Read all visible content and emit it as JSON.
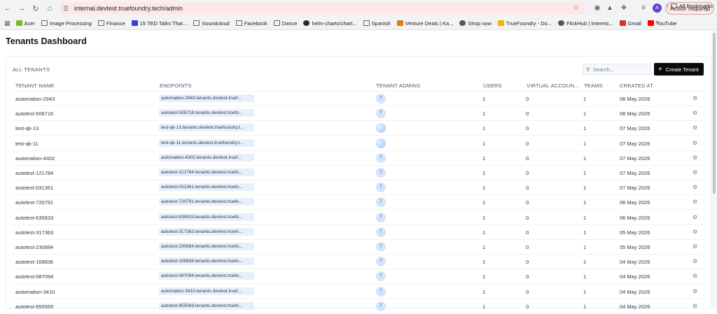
{
  "browser": {
    "url": "internal.devtest.truefoundry.tech/admin",
    "action_required": "Action required",
    "profile_initial": "A",
    "bookmarks": [
      {
        "label": "Acer",
        "icon": "acer-icon"
      },
      {
        "label": "Image Processing",
        "icon": "folder-icon"
      },
      {
        "label": "Finance",
        "icon": "folder-icon"
      },
      {
        "label": "15 TED Talks That...",
        "icon": "ted-icon"
      },
      {
        "label": "Soundcloud",
        "icon": "folder-icon"
      },
      {
        "label": "Facebook",
        "icon": "folder-icon"
      },
      {
        "label": "Dance",
        "icon": "folder-icon"
      },
      {
        "label": "helm-charts/chart...",
        "icon": "github-icon"
      },
      {
        "label": "Spanish",
        "icon": "folder-icon"
      },
      {
        "label": "Venture Deals | Ka...",
        "icon": "kindle-icon"
      },
      {
        "label": "Shop now",
        "icon": "globe-icon"
      },
      {
        "label": "TrueFoundry - Do...",
        "icon": "drive-icon"
      },
      {
        "label": "FlickHub | Interest...",
        "icon": "globe-icon"
      },
      {
        "label": "Gmail",
        "icon": "gmail-icon"
      },
      {
        "label": "YouTube",
        "icon": "youtube-icon"
      }
    ],
    "all_bookmarks": "All Bookmarks"
  },
  "page": {
    "title": "Tenants Dashboard",
    "section_label": "ALL TENANTS",
    "search_placeholder": "Search...",
    "create_button": "Create Tenant"
  },
  "table": {
    "headers": {
      "name": "TENANT NAME",
      "endpoints": "ENDPOINTS",
      "admins": "TENANT ADMINS",
      "users": "USERS",
      "virtual": "VIRTUAL ACCOUN...",
      "teams": "TEAMS",
      "created": "CREATED AT"
    },
    "rows": [
      {
        "name": "automation-2943",
        "endpoint": "automation-2943.tenants.devtest.truef...",
        "admin": "T",
        "admin_type": "initial",
        "users": "1",
        "virtual": "0",
        "teams": "1",
        "created": "08 May 2026"
      },
      {
        "name": "autotest-506716",
        "endpoint": "autotest-506716.tenants.devtest.truefo...",
        "admin": "T",
        "admin_type": "initial",
        "users": "1",
        "virtual": "0",
        "teams": "1",
        "created": "08 May 2026"
      },
      {
        "name": "test-qk-13",
        "endpoint": "test-qk-13.tenants.devtest.truefoundry.t...",
        "admin": "",
        "admin_type": "image",
        "users": "1",
        "virtual": "0",
        "teams": "1",
        "created": "07 May 2026"
      },
      {
        "name": "test-qk-11",
        "endpoint": "test-qk-11.tenants.devtest.truefoundry.t...",
        "admin": "",
        "admin_type": "image",
        "users": "1",
        "virtual": "0",
        "teams": "1",
        "created": "07 May 2026"
      },
      {
        "name": "automation-4302",
        "endpoint": "automation-4302.tenants.devtest.truef...",
        "admin": "T",
        "admin_type": "initial",
        "users": "1",
        "virtual": "0",
        "teams": "1",
        "created": "07 May 2026"
      },
      {
        "name": "autotest-121784",
        "endpoint": "autotest-121784.tenants.devtest.truefo...",
        "admin": "T",
        "admin_type": "initial",
        "users": "1",
        "virtual": "0",
        "teams": "1",
        "created": "07 May 2026"
      },
      {
        "name": "autotest-031361",
        "endpoint": "autotest-031361.tenants.devtest.truefo...",
        "admin": "T",
        "admin_type": "initial",
        "users": "1",
        "virtual": "0",
        "teams": "1",
        "created": "07 May 2026"
      },
      {
        "name": "autotest-720791",
        "endpoint": "autotest-720791.tenants.devtest.truefo...",
        "admin": "T",
        "admin_type": "initial",
        "users": "1",
        "virtual": "0",
        "teams": "1",
        "created": "06 May 2026"
      },
      {
        "name": "autotest-635633",
        "endpoint": "autotest-635633.tenants.devtest.truefo...",
        "admin": "T",
        "admin_type": "initial",
        "users": "1",
        "virtual": "0",
        "teams": "1",
        "created": "06 May 2026"
      },
      {
        "name": "autotest-317363",
        "endpoint": "autotest-317363.tenants.devtest.truefo...",
        "admin": "T",
        "admin_type": "initial",
        "users": "1",
        "virtual": "0",
        "teams": "1",
        "created": "05 May 2026"
      },
      {
        "name": "autotest-230684",
        "endpoint": "autotest-230684.tenants.devtest.truefo...",
        "admin": "T",
        "admin_type": "initial",
        "users": "1",
        "virtual": "0",
        "teams": "1",
        "created": "05 May 2026"
      },
      {
        "name": "autotest-168836",
        "endpoint": "autotest-168836.tenants.devtest.truefo...",
        "admin": "T",
        "admin_type": "initial",
        "users": "1",
        "virtual": "0",
        "teams": "1",
        "created": "04 May 2026"
      },
      {
        "name": "autotest-087094",
        "endpoint": "autotest-087094.tenants.devtest.truefo...",
        "admin": "T",
        "admin_type": "initial",
        "users": "1",
        "virtual": "0",
        "teams": "1",
        "created": "04 May 2026"
      },
      {
        "name": "automation-3410",
        "endpoint": "automation-3410.tenants.devtest.truef...",
        "admin": "T",
        "admin_type": "initial",
        "users": "1",
        "virtual": "0",
        "teams": "1",
        "created": "04 May 2026"
      },
      {
        "name": "autotest-955569",
        "endpoint": "autotest-955569.tenants.devtest.truefo...",
        "admin": "T",
        "admin_type": "initial",
        "users": "1",
        "virtual": "0",
        "teams": "1",
        "created": "04 May 2026"
      }
    ]
  },
  "colors": {
    "accent_dark": "#0b0b0b",
    "endpoint_chip": "#e6f0fb",
    "admin_avatar": "#d2e6fb",
    "omnibox": "#fde8e8"
  }
}
